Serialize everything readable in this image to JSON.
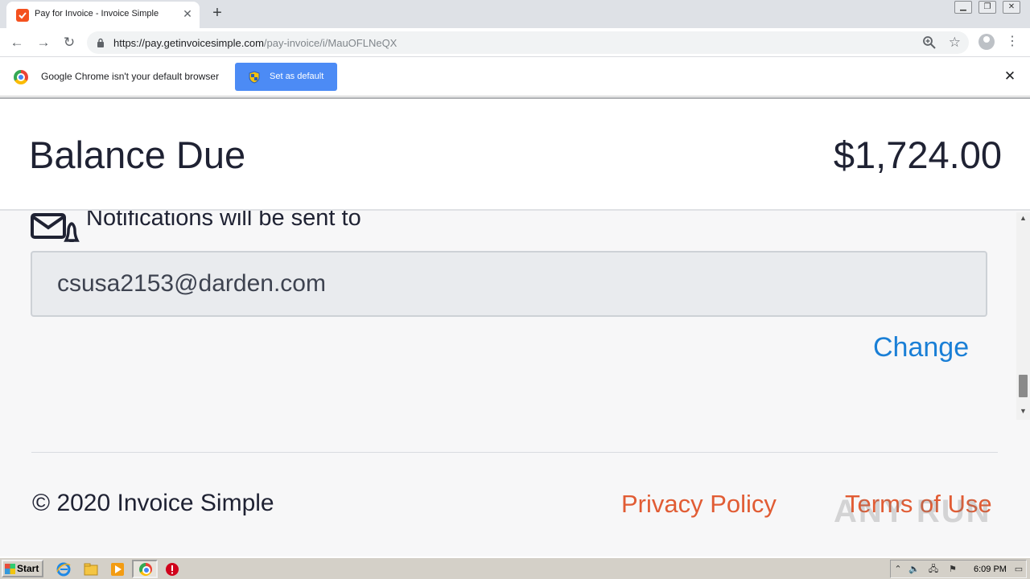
{
  "browser": {
    "tab_title": "Pay for Invoice - Invoice Simple",
    "tab_close": "✕",
    "new_tab": "+",
    "url_domain": "https://pay.getinvoicesimple.com",
    "url_path": "/pay-invoice/i/MauOFLNeQX"
  },
  "infobar": {
    "message": "Google Chrome isn't your default browser",
    "button_label": "Set as default",
    "close": "✕"
  },
  "balance": {
    "label": "Balance Due",
    "amount": "$1,724.00"
  },
  "notifications": {
    "heading": "Notifications will be sent to",
    "email": "csusa2153@darden.com",
    "change_label": "Change"
  },
  "footer": {
    "copyright": "© 2020 Invoice Simple",
    "privacy": "Privacy Policy",
    "terms": "Terms of Use"
  },
  "watermark": "ANY RUN",
  "taskbar": {
    "start_label": "Start",
    "clock": "6:09 PM"
  },
  "colors": {
    "accent_link": "#1a7fd6",
    "footer_link": "#e15c34",
    "brand_favicon": "#f4511e",
    "set_default_button": "#4c8bf5"
  }
}
